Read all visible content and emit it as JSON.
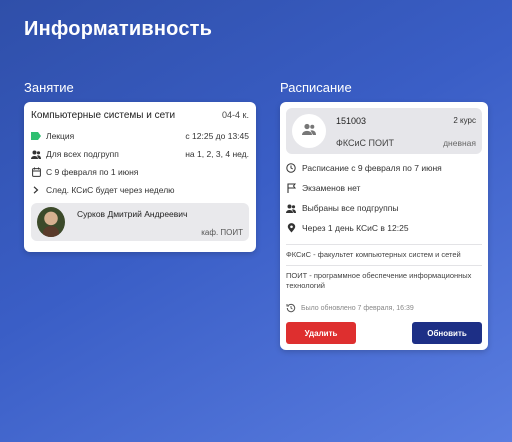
{
  "page": {
    "title": "Информативность"
  },
  "lesson": {
    "section_title": "Занятие",
    "name": "Компьютерные системы и сети",
    "room": "04-4 к.",
    "type": "Лекция",
    "time": "с 12:25 до 13:45",
    "subgroups": "Для всех подгрупп",
    "weeks": "на 1, 2, 3, 4 нед.",
    "dates": "С 9 февраля по 1 июня",
    "next": "След. КСиС будет через неделю",
    "teacher": {
      "name": "Сурков Дмитрий Андреевич",
      "dept": "каф. ПОИТ"
    },
    "type_color": "#2fbf71"
  },
  "schedule": {
    "section_title": "Расписание",
    "group": {
      "number": "151003",
      "course": "2 курс",
      "faculty": "ФКСиС ПОИТ",
      "form": "дневная"
    },
    "rows": [
      {
        "icon": "clock-icon",
        "text": "Расписание с 9 февраля по 7 июня"
      },
      {
        "icon": "flag-icon",
        "text": "Экзаменов нет"
      },
      {
        "icon": "group-icon",
        "text": "Выбраны все подгруппы"
      },
      {
        "icon": "location-icon",
        "text": "Через 1 день КСиС в 12:25"
      }
    ],
    "notes": [
      "ФКСиС - факультет компьютерных систем и сетей",
      "ПОИТ - программное обеспечение информационных технологий"
    ],
    "updated": "Было обновлено 7 февраля, 16:39",
    "delete_label": "Удалить",
    "update_label": "Обновить"
  }
}
